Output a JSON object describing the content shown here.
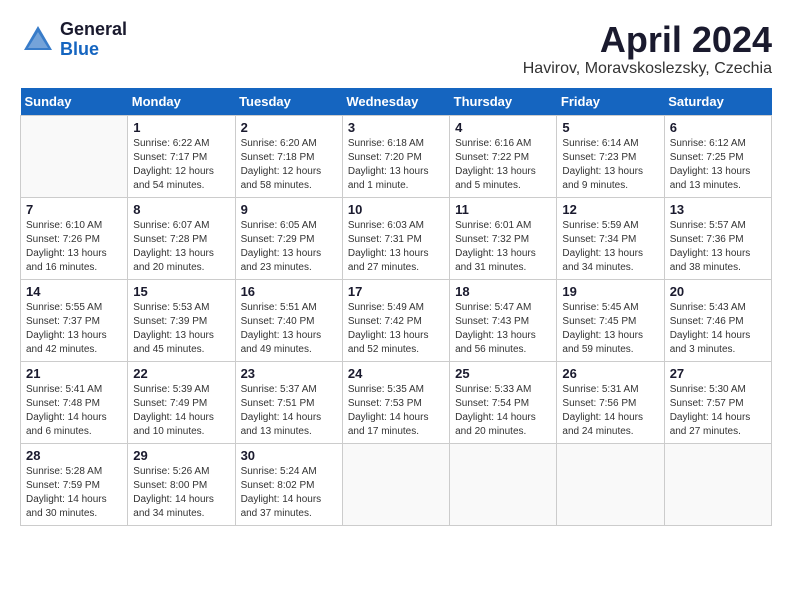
{
  "header": {
    "logo_general": "General",
    "logo_blue": "Blue",
    "month_title": "April 2024",
    "location": "Havirov, Moravskoslezsky, Czechia"
  },
  "calendar": {
    "days_of_week": [
      "Sunday",
      "Monday",
      "Tuesday",
      "Wednesday",
      "Thursday",
      "Friday",
      "Saturday"
    ],
    "weeks": [
      [
        {
          "day": "",
          "info": ""
        },
        {
          "day": "1",
          "info": "Sunrise: 6:22 AM\nSunset: 7:17 PM\nDaylight: 12 hours\nand 54 minutes."
        },
        {
          "day": "2",
          "info": "Sunrise: 6:20 AM\nSunset: 7:18 PM\nDaylight: 12 hours\nand 58 minutes."
        },
        {
          "day": "3",
          "info": "Sunrise: 6:18 AM\nSunset: 7:20 PM\nDaylight: 13 hours\nand 1 minute."
        },
        {
          "day": "4",
          "info": "Sunrise: 6:16 AM\nSunset: 7:22 PM\nDaylight: 13 hours\nand 5 minutes."
        },
        {
          "day": "5",
          "info": "Sunrise: 6:14 AM\nSunset: 7:23 PM\nDaylight: 13 hours\nand 9 minutes."
        },
        {
          "day": "6",
          "info": "Sunrise: 6:12 AM\nSunset: 7:25 PM\nDaylight: 13 hours\nand 13 minutes."
        }
      ],
      [
        {
          "day": "7",
          "info": "Sunrise: 6:10 AM\nSunset: 7:26 PM\nDaylight: 13 hours\nand 16 minutes."
        },
        {
          "day": "8",
          "info": "Sunrise: 6:07 AM\nSunset: 7:28 PM\nDaylight: 13 hours\nand 20 minutes."
        },
        {
          "day": "9",
          "info": "Sunrise: 6:05 AM\nSunset: 7:29 PM\nDaylight: 13 hours\nand 23 minutes."
        },
        {
          "day": "10",
          "info": "Sunrise: 6:03 AM\nSunset: 7:31 PM\nDaylight: 13 hours\nand 27 minutes."
        },
        {
          "day": "11",
          "info": "Sunrise: 6:01 AM\nSunset: 7:32 PM\nDaylight: 13 hours\nand 31 minutes."
        },
        {
          "day": "12",
          "info": "Sunrise: 5:59 AM\nSunset: 7:34 PM\nDaylight: 13 hours\nand 34 minutes."
        },
        {
          "day": "13",
          "info": "Sunrise: 5:57 AM\nSunset: 7:36 PM\nDaylight: 13 hours\nand 38 minutes."
        }
      ],
      [
        {
          "day": "14",
          "info": "Sunrise: 5:55 AM\nSunset: 7:37 PM\nDaylight: 13 hours\nand 42 minutes."
        },
        {
          "day": "15",
          "info": "Sunrise: 5:53 AM\nSunset: 7:39 PM\nDaylight: 13 hours\nand 45 minutes."
        },
        {
          "day": "16",
          "info": "Sunrise: 5:51 AM\nSunset: 7:40 PM\nDaylight: 13 hours\nand 49 minutes."
        },
        {
          "day": "17",
          "info": "Sunrise: 5:49 AM\nSunset: 7:42 PM\nDaylight: 13 hours\nand 52 minutes."
        },
        {
          "day": "18",
          "info": "Sunrise: 5:47 AM\nSunset: 7:43 PM\nDaylight: 13 hours\nand 56 minutes."
        },
        {
          "day": "19",
          "info": "Sunrise: 5:45 AM\nSunset: 7:45 PM\nDaylight: 13 hours\nand 59 minutes."
        },
        {
          "day": "20",
          "info": "Sunrise: 5:43 AM\nSunset: 7:46 PM\nDaylight: 14 hours\nand 3 minutes."
        }
      ],
      [
        {
          "day": "21",
          "info": "Sunrise: 5:41 AM\nSunset: 7:48 PM\nDaylight: 14 hours\nand 6 minutes."
        },
        {
          "day": "22",
          "info": "Sunrise: 5:39 AM\nSunset: 7:49 PM\nDaylight: 14 hours\nand 10 minutes."
        },
        {
          "day": "23",
          "info": "Sunrise: 5:37 AM\nSunset: 7:51 PM\nDaylight: 14 hours\nand 13 minutes."
        },
        {
          "day": "24",
          "info": "Sunrise: 5:35 AM\nSunset: 7:53 PM\nDaylight: 14 hours\nand 17 minutes."
        },
        {
          "day": "25",
          "info": "Sunrise: 5:33 AM\nSunset: 7:54 PM\nDaylight: 14 hours\nand 20 minutes."
        },
        {
          "day": "26",
          "info": "Sunrise: 5:31 AM\nSunset: 7:56 PM\nDaylight: 14 hours\nand 24 minutes."
        },
        {
          "day": "27",
          "info": "Sunrise: 5:30 AM\nSunset: 7:57 PM\nDaylight: 14 hours\nand 27 minutes."
        }
      ],
      [
        {
          "day": "28",
          "info": "Sunrise: 5:28 AM\nSunset: 7:59 PM\nDaylight: 14 hours\nand 30 minutes."
        },
        {
          "day": "29",
          "info": "Sunrise: 5:26 AM\nSunset: 8:00 PM\nDaylight: 14 hours\nand 34 minutes."
        },
        {
          "day": "30",
          "info": "Sunrise: 5:24 AM\nSunset: 8:02 PM\nDaylight: 14 hours\nand 37 minutes."
        },
        {
          "day": "",
          "info": ""
        },
        {
          "day": "",
          "info": ""
        },
        {
          "day": "",
          "info": ""
        },
        {
          "day": "",
          "info": ""
        }
      ]
    ]
  }
}
